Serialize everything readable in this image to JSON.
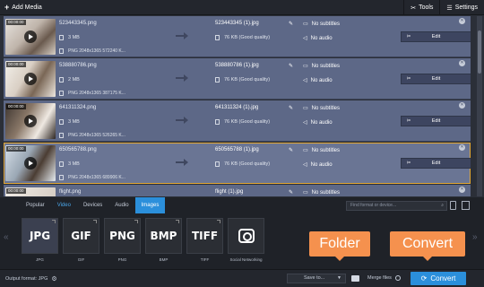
{
  "toolbar": {
    "add_media": "Add Media",
    "tools": "Tools",
    "settings": "Settings"
  },
  "files": [
    {
      "time": "00:00:00",
      "name": "523443345.png",
      "size": "3 MB",
      "info": "PNG 2048x1365 572240 K...",
      "out_name": "523443345 (1).jpg",
      "out_size": "76 KB (Good quality)",
      "subtitles": "No subtitles",
      "audio": "No audio",
      "edit": "Edit"
    },
    {
      "time": "00:00:00",
      "name": "538880786.png",
      "size": "2 MB",
      "info": "PNG 2048x1365 387175 K...",
      "out_name": "538880786 (1).jpg",
      "out_size": "76 KB (Good quality)",
      "subtitles": "No subtitles",
      "audio": "No audio",
      "edit": "Edit"
    },
    {
      "time": "00:00:00",
      "name": "641311324.png",
      "size": "3 MB",
      "info": "PNG 2048x1365 526265 K...",
      "out_name": "641311324 (1).jpg",
      "out_size": "76 KB (Good quality)",
      "subtitles": "No subtitles",
      "audio": "No audio",
      "edit": "Edit"
    },
    {
      "time": "00:00:00",
      "name": "650565788.png",
      "size": "3 MB",
      "info": "PNG 2048x1365 689906 K...",
      "out_name": "650565788 (1).jpg",
      "out_size": "76 KB (Good quality)",
      "subtitles": "No subtitles",
      "audio": "No audio",
      "edit": "Edit"
    },
    {
      "time": "00:00:00",
      "name": "flight.png",
      "size": "",
      "info": "",
      "out_name": "flight (1).jpg",
      "out_size": "",
      "subtitles": "No subtitles",
      "audio": "",
      "edit": ""
    }
  ],
  "panel": {
    "tabs": [
      "Popular",
      "Video",
      "Devices",
      "Audio",
      "Images"
    ],
    "search_placeholder": "Find format or device...",
    "formats": [
      {
        "label": "JPG",
        "name": "JPG"
      },
      {
        "label": "GIF",
        "name": "GIF"
      },
      {
        "label": "PNG",
        "name": "PNG"
      },
      {
        "label": "BMP",
        "name": "BMP"
      },
      {
        "label": "TIFF",
        "name": "TIFF"
      },
      {
        "label": "",
        "name": "Social Networking"
      }
    ]
  },
  "callouts": {
    "folder": "Folder",
    "convert": "Convert"
  },
  "bottom": {
    "output_format": "Output format: JPG",
    "save_to": "Save to...",
    "merge": "Merge files",
    "convert": "Convert"
  },
  "colors": {
    "accent": "#2b8fdb",
    "callout": "#f5914e",
    "selection": "#e2a733"
  }
}
